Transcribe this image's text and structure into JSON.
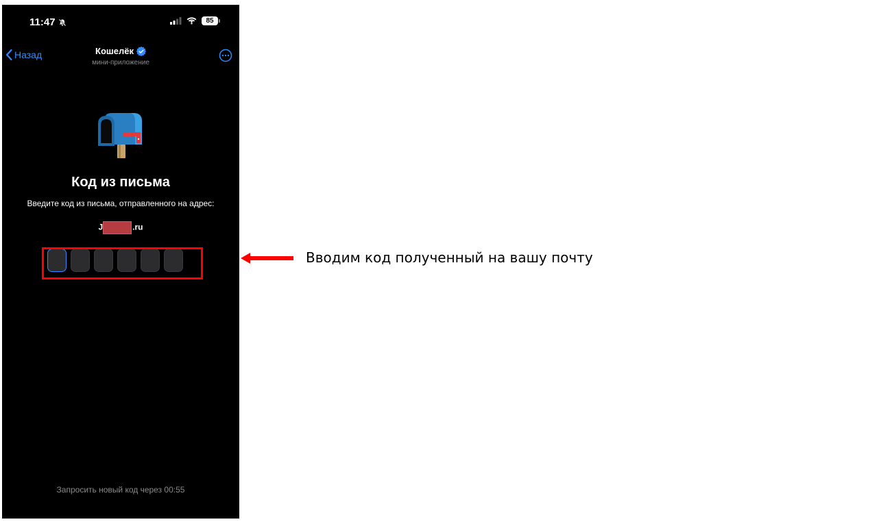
{
  "status_bar": {
    "time": "11:47",
    "battery": "85"
  },
  "nav": {
    "back_label": "Назад",
    "title": "Кошелёк",
    "subtitle": "мини-приложение"
  },
  "main": {
    "title": "Код из письма",
    "description": "Введите код из письма, отправленного на адрес:",
    "email_visible_start": "J",
    "email_visible_end": ".ru",
    "code_cells": [
      "",
      "",
      "",
      "",
      "",
      ""
    ],
    "active_cell_index": 0
  },
  "footer": {
    "resend_text": "Запросить новый код через 00:55"
  },
  "annotation": {
    "text": "Вводим код полученный на вашу почту"
  },
  "colors": {
    "accent": "#2f8cff",
    "highlight": "#ff0000",
    "background": "#000000"
  }
}
